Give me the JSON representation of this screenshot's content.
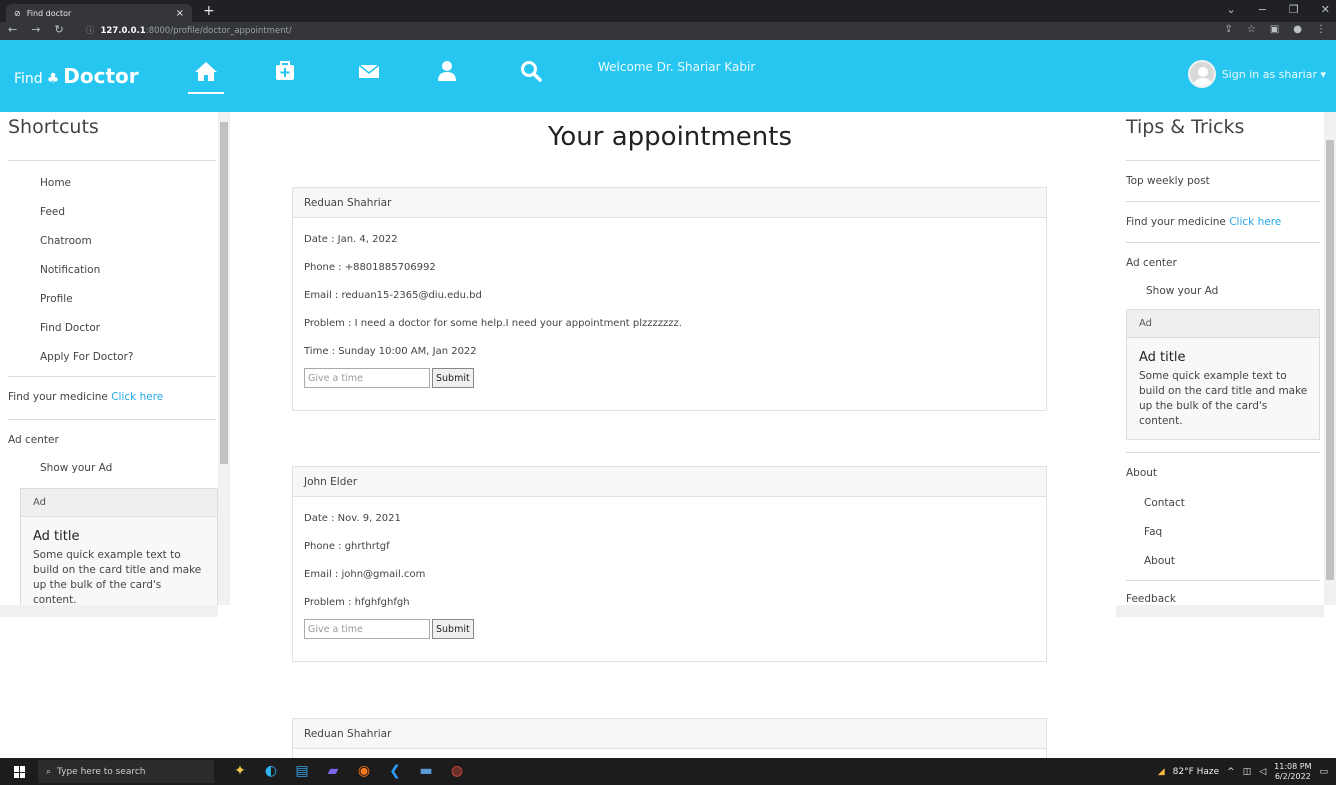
{
  "browser": {
    "tab_title": "Find doctor",
    "tab_close": "×",
    "new_tab": "+",
    "url_info": "ⓘ",
    "url_host": "127.0.0.1",
    "url_path": ":8000/profile/doctor_appointment/"
  },
  "navbar": {
    "brand_prefix": "Find",
    "brand_name": "Doctor",
    "welcome": "Welcome Dr. Shariar Kabir",
    "signin": "Sign in as shariar ▾",
    "icons": [
      "home-icon",
      "medkit-icon",
      "envelope-icon",
      "user-md-icon",
      "search-icon"
    ]
  },
  "left_sidebar": {
    "heading": "Shortcuts",
    "items": [
      "Home",
      "Feed",
      "Chatroom",
      "Notification",
      "Profile",
      "Find Doctor",
      "Apply For Doctor?"
    ],
    "medicine_text": "Find your medicine",
    "medicine_link": "Click here",
    "ad_center": "Ad center",
    "show_ad": "Show your Ad",
    "ad_header": "Ad",
    "ad_title": "Ad title",
    "ad_text": "Some quick example text to build on the card title and make up the bulk of the card's content."
  },
  "main": {
    "title": "Your appointments",
    "appointments": [
      {
        "name": "Reduan Shahriar",
        "date": "Date : Jan. 4, 2022",
        "phone": "Phone : +8801885706992",
        "email": "Email : reduan15-2365@diu.edu.bd",
        "problem": "Problem : I need a doctor for some help.I need your appointment plzzzzzzz.",
        "time": "Time : Sunday 10:00 AM, Jan 2022",
        "placeholder": "Give a time",
        "submit": "Submit"
      },
      {
        "name": "John Elder",
        "date": "Date : Nov. 9, 2021",
        "phone": "Phone : ghrthrtgf",
        "email": "Email : john@gmail.com",
        "problem": "Problem : hfghfghfgh",
        "placeholder": "Give a time",
        "submit": "Submit"
      },
      {
        "name": "Reduan Shahriar"
      }
    ]
  },
  "right_sidebar": {
    "heading": "Tips & Tricks",
    "top_weekly": "Top weekly post",
    "medicine_text": "Find your medicine",
    "medicine_link": "Click here",
    "ad_center": "Ad center",
    "show_ad": "Show your Ad",
    "ad_header": "Ad",
    "ad_title": "Ad title",
    "ad_text": "Some quick example text to build on the card title and make up the bulk of the card's content.",
    "about_heading": "About",
    "about_items": [
      "Contact",
      "Faq",
      "About"
    ],
    "feedback": "Feedback"
  },
  "taskbar": {
    "search_placeholder": "Type here to search",
    "weather": "82°F  Haze",
    "time": "11:08 PM",
    "date": "6/2/2022"
  },
  "colors": {
    "navbar": "#26c6f0",
    "link": "#26a7e8"
  }
}
